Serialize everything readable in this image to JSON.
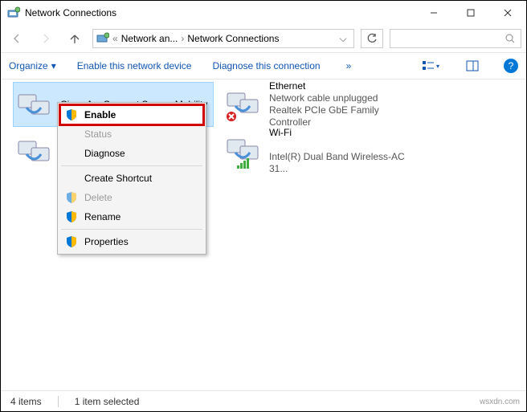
{
  "window": {
    "title": "Network Connections"
  },
  "breadcrumb": {
    "seg1": "Network an...",
    "seg2": "Network Connections"
  },
  "search": {
    "placeholder": ""
  },
  "cmdbar": {
    "organize": "Organize",
    "enable": "Enable this network device",
    "diagnose": "Diagnose this connection"
  },
  "adapters": {
    "cisco": {
      "name": "Cisco AnyConnect Secure Mobility",
      "status": "",
      "driver": ""
    },
    "ethernet": {
      "name": "Ethernet",
      "status": "Network cable unplugged",
      "driver": "Realtek PCIe GbE Family Controller"
    },
    "unknown": {
      "name": "",
      "status": "",
      "driver": ""
    },
    "wifi": {
      "name": "Wi-Fi",
      "status": "",
      "driver": "Intel(R) Dual Band Wireless-AC 31..."
    }
  },
  "context_menu": {
    "enable": "Enable",
    "status": "Status",
    "diagnose": "Diagnose",
    "create_shortcut": "Create Shortcut",
    "delete": "Delete",
    "rename": "Rename",
    "properties": "Properties"
  },
  "statusbar": {
    "count": "4 items",
    "selection": "1 item selected"
  },
  "watermark": "wsxdn.com"
}
